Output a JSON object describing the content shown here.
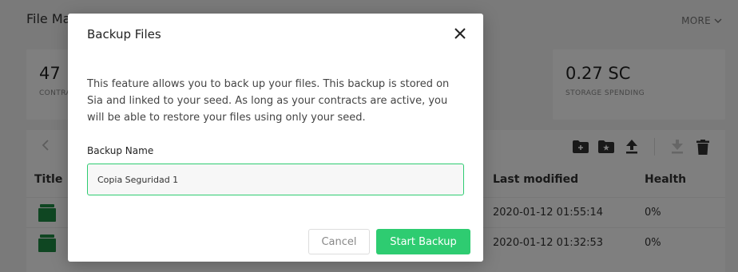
{
  "app": {
    "title": "File Manager",
    "more_label": "MORE"
  },
  "stats": [
    {
      "value": "47",
      "label": "CONTRACTS"
    },
    {
      "value": "0.27 SC",
      "label": "STORAGE SPENDING"
    }
  ],
  "table": {
    "headers": {
      "title": "Title",
      "modified": "Last modified",
      "health": "Health"
    },
    "rows": [
      {
        "modified": "2020-01-12 01:55:14",
        "health": "0%"
      },
      {
        "modified": "2020-01-12 01:32:53",
        "health": "0%"
      }
    ]
  },
  "modal": {
    "title": "Backup Files",
    "description": "This feature allows you to back up your files. This backup is stored on Sia and linked to your seed. As long as your contracts are active, you will be able to restore your files using only your seed.",
    "field_label": "Backup Name",
    "field_value": "Copia Seguridad 1",
    "cancel_label": "Cancel",
    "start_label": "Start Backup"
  },
  "colors": {
    "accent": "#2ecc71",
    "file_icon": "#1e8c45"
  },
  "icons": [
    "close-icon",
    "chevron-down-icon",
    "back-arrow-icon",
    "new-folder-icon",
    "starred-folder-icon",
    "upload-icon",
    "download-icon",
    "trash-icon",
    "file-icon"
  ]
}
